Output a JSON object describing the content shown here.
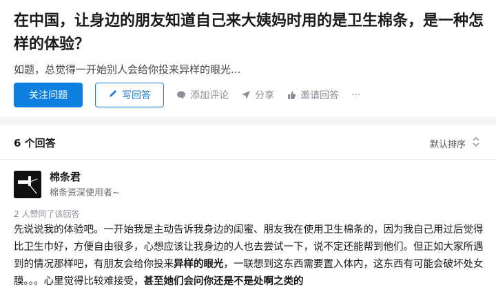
{
  "question": {
    "title": "在中国，让身边的朋友知道自己来大姨妈时用的是卫生棉条，是一种怎样的体验？",
    "detail": "如题，总觉得一开始别人会给你投来异样的眼光..."
  },
  "actions": {
    "follow_label": "关注问题",
    "write_label": "写回答",
    "comment_label": "添加评论",
    "share_label": "分享",
    "invite_label": "邀请回答",
    "more_label": "···"
  },
  "answers": {
    "count_label": "6 个回答",
    "sort_label": "默认排序"
  },
  "answer": {
    "author_name": "棉条君",
    "author_bio": "棉条资深使用者~",
    "votes_label": "2 人赞同了该回答",
    "content_segments": [
      {
        "text": "先说说我的体验吧。一开始我是主动告诉我身边的闺蜜、朋友我在使用卫生棉条的，因为我自己用过后觉得比卫生巾好，方便自由很多，心想应该让我身边的人也去尝试一下，说不定还能帮到他们。但正如大家所遇到的情况那样吧，有朋友会给你投来",
        "bold": false
      },
      {
        "text": "异样的眼光",
        "bold": true
      },
      {
        "text": "，一联想到这东西需要置入体内，这东西有可能会破坏处女膜。。。心里觉得比较难接受，",
        "bold": false
      },
      {
        "text": "甚至她们会问你还是不是处啊之类的",
        "bold": true
      }
    ]
  },
  "colors": {
    "primary": "#0f7fe0",
    "muted": "#8a8f97",
    "divider": "#f3f4f6"
  },
  "icons": {
    "write": "pencil-icon",
    "comment": "speech-bubble-icon",
    "share": "paper-plane-icon",
    "invite": "hand-icon",
    "sort": "up-down-chevron-icon"
  }
}
